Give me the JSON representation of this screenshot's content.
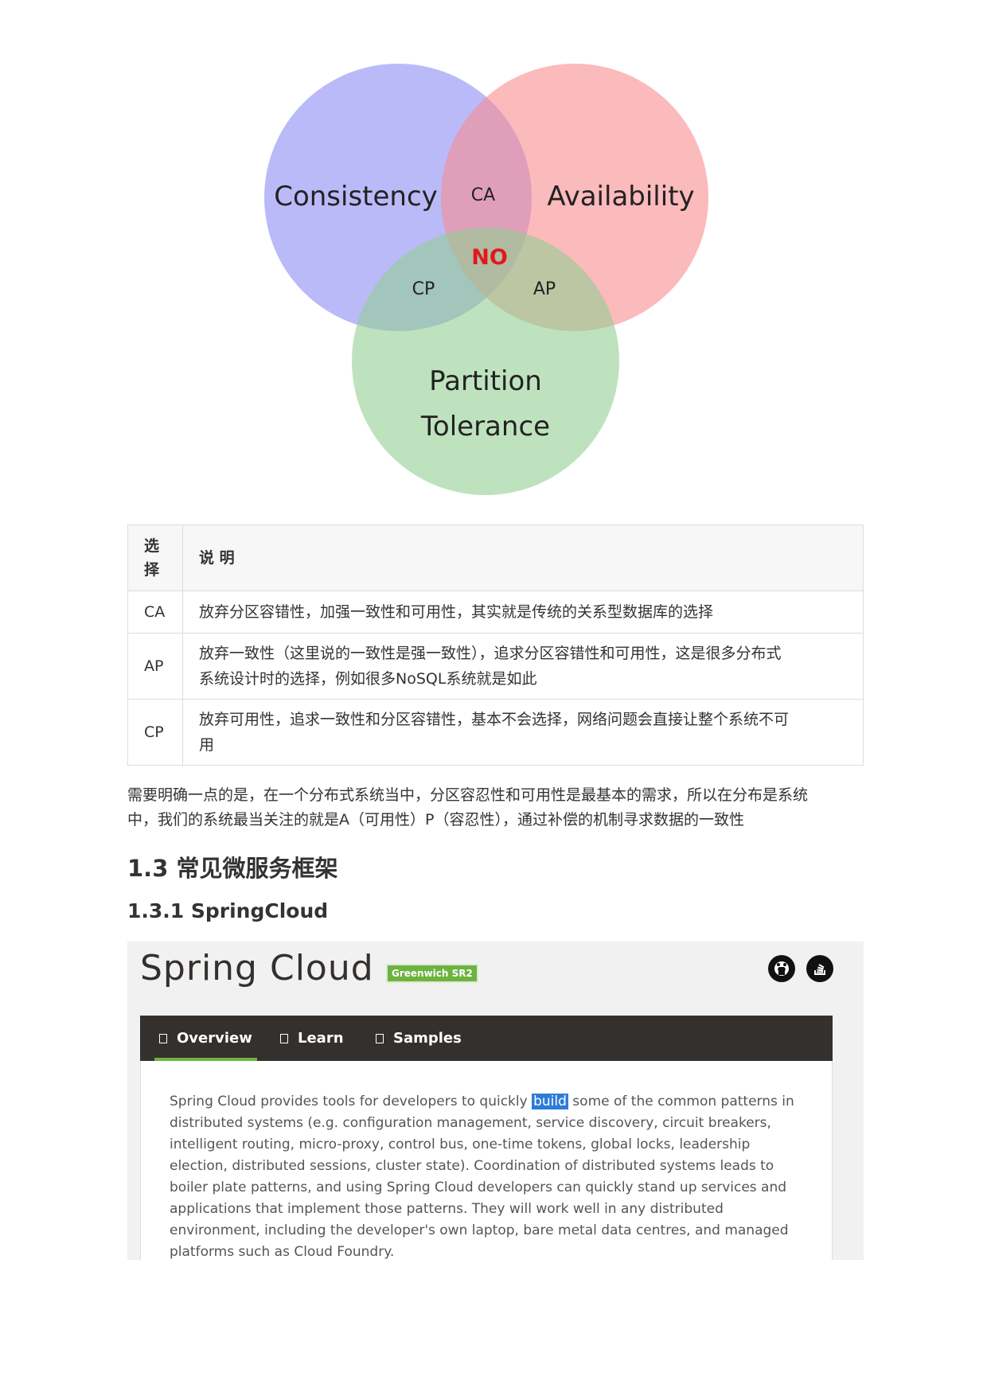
{
  "venn": {
    "circle_colors": {
      "consistency": "#a9a9f7",
      "availability": "#f9a6a8",
      "partition": "#a8d8a8",
      "no_color": "#e0191e"
    },
    "consistency": "Consistency",
    "availability": "Availability",
    "partition_line1": "Partition",
    "partition_line2": "Tolerance",
    "ca": "CA",
    "cp": "CP",
    "ap": "AP",
    "no": "NO"
  },
  "table": {
    "header_option_line1": "选",
    "header_option_line2": "择",
    "header_desc": "说 明",
    "rows": [
      {
        "option": "CA",
        "desc_line1": "放弃分区容错性，加强一致性和可用性，其实就是传统的关系型数据库的选择",
        "desc_line2": ""
      },
      {
        "option": "AP",
        "desc_line1": "放弃一致性（这里说的一致性是强一致性），追求分区容错性和可用性，这是很多分布式",
        "desc_line2": "系统设计时的选择，例如很多NoSQL系统就是如此"
      },
      {
        "option": "CP",
        "desc_line1": "放弃可用性，追求一致性和分区容错性，基本不会选择，网络问题会直接让整个系统不可",
        "desc_line2": "用"
      }
    ]
  },
  "paragraph": {
    "line1": "需要明确一点的是，在一个分布式系统当中，分区容忍性和可用性是最基本的需求，所以在分布是系统",
    "line2": "中，我们的系统最当关注的就是A（可用性）P（容忍性），通过补偿的机制寻求数据的一致性"
  },
  "heading_2": "1.3 常见微服务框架",
  "heading_3": "1.3.1 SpringCloud",
  "spring": {
    "title": "Spring Cloud",
    "version": "Greenwich SR2",
    "tabs": {
      "overview": "Overview",
      "learn": "Learn",
      "samples": "Samples"
    },
    "accent": "#6db33f",
    "desc_before": "Spring Cloud provides tools for developers to quickly ",
    "desc_highlight": "build",
    "desc_after": " some of the common patterns in distributed systems (e.g. configuration management, service discovery, circuit breakers, intelligent routing, micro-proxy, control bus, one-time tokens, global locks, leadership election, distributed sessions, cluster state). Coordination of distributed systems leads to boiler plate patterns, and using Spring Cloud developers can quickly stand up services and applications that implement those patterns. They will work well in any distributed environment, including the developer's own laptop, bare metal data centres, and managed platforms such as Cloud Foundry."
  }
}
